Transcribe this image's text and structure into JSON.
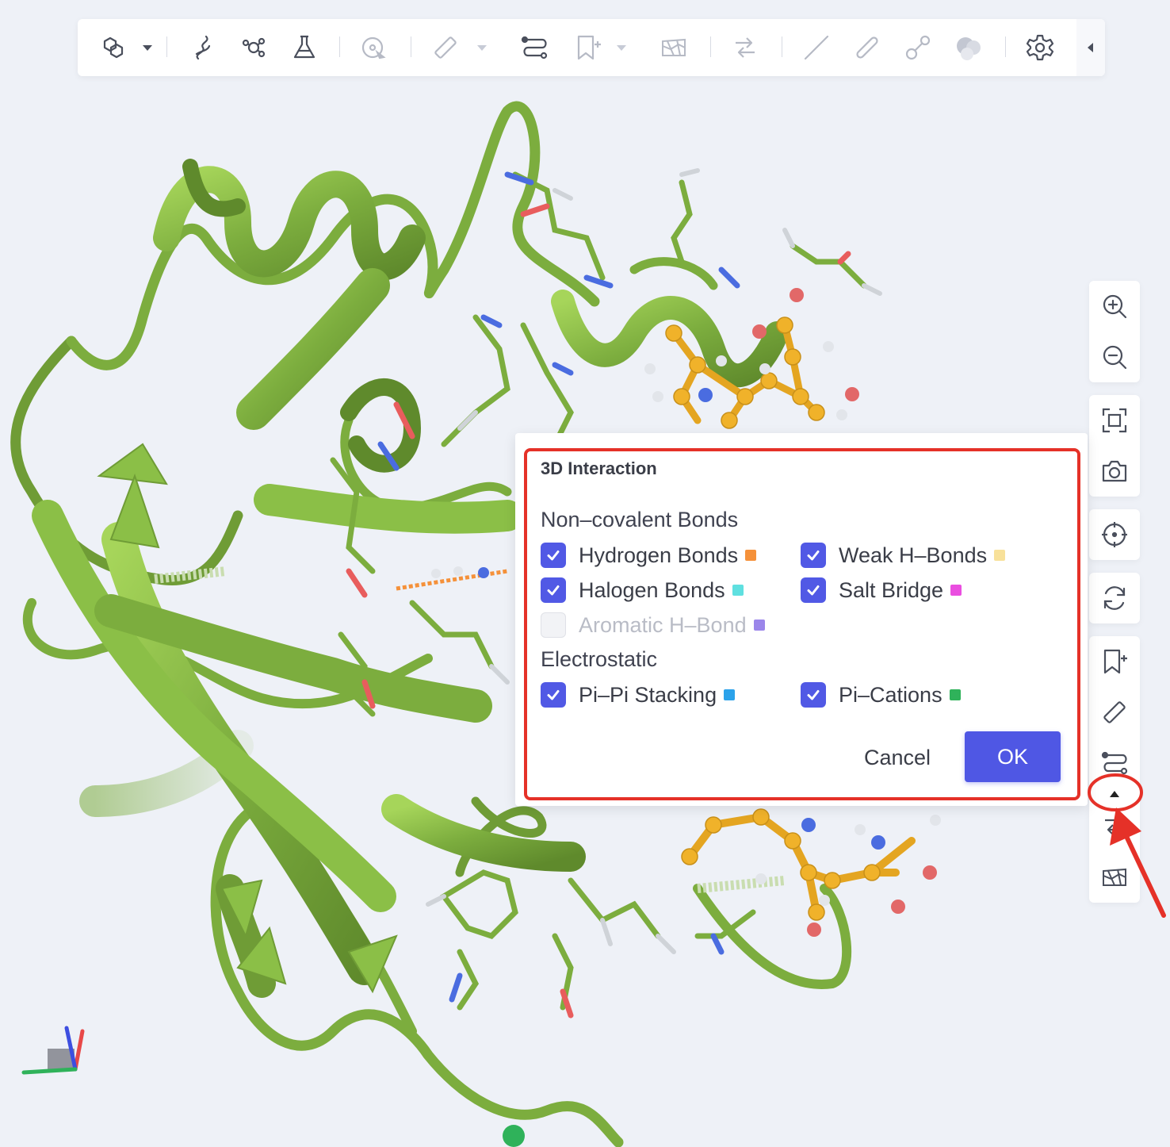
{
  "toolbar": {
    "buttons": [
      {
        "icon": "molecule-style-icon",
        "has_dropdown": true
      },
      {
        "icon": "helix-icon"
      },
      {
        "icon": "ligand-icon"
      },
      {
        "icon": "flask-icon"
      },
      {
        "icon": "target-select-icon"
      },
      {
        "icon": "ruler-icon",
        "has_dropdown": true
      },
      {
        "icon": "interaction-path-icon"
      },
      {
        "icon": "bookmark-add-icon",
        "has_dropdown": true
      },
      {
        "icon": "surface-map-icon"
      },
      {
        "icon": "transfer-icon"
      },
      {
        "icon": "line-style-icon"
      },
      {
        "icon": "stick-style-icon"
      },
      {
        "icon": "ball-stick-icon"
      },
      {
        "icon": "spacefill-icon"
      },
      {
        "icon": "settings-gear-icon"
      }
    ]
  },
  "sidebar": {
    "items": [
      "zoom-in-icon",
      "zoom-out-icon",
      "fit-screen-icon",
      "camera-icon",
      "center-target-icon",
      "reset-rotation-icon",
      "bookmark-add-icon",
      "ruler-icon",
      "interaction-path-icon",
      "collapse-up-icon",
      "transfer-icon",
      "surface-map-icon"
    ]
  },
  "dialog": {
    "title": "3D Interaction",
    "noncovalent": {
      "title": "Non–covalent Bonds",
      "items": [
        {
          "label": "Hydrogen Bonds",
          "checked": true,
          "color": "#f5913a"
        },
        {
          "label": "Weak H–Bonds",
          "checked": true,
          "color": "#f8e19a"
        },
        {
          "label": "Halogen Bonds",
          "checked": true,
          "color": "#5fe0e0"
        },
        {
          "label": "Salt Bridge",
          "checked": true,
          "color": "#ea4ee0"
        },
        {
          "label": "Aromatic H–Bond",
          "checked": false,
          "disabled": true,
          "color": "#9b86ea"
        }
      ]
    },
    "electrostatic": {
      "title": "Electrostatic",
      "items": [
        {
          "label": "Pi–Pi Stacking",
          "checked": true,
          "color": "#2ba2ea"
        },
        {
          "label": "Pi–Cations",
          "checked": true,
          "color": "#2fb25a"
        }
      ]
    },
    "cancel_label": "Cancel",
    "ok_label": "OK"
  },
  "colors": {
    "ribbon": "#7cad3e",
    "ribbon_light": "#9fd051",
    "ligand": "#f0b22a",
    "accent": "#4f57e4",
    "highlight": "#e53128"
  }
}
